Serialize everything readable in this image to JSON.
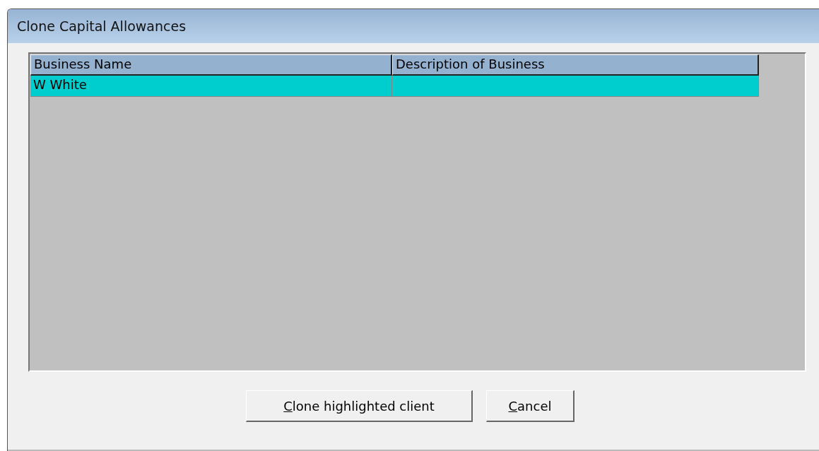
{
  "window": {
    "title": "Clone Capital Allowances"
  },
  "table": {
    "columns": [
      "Business Name",
      "Description of Business"
    ],
    "rows": [
      {
        "cells": [
          "W White",
          ""
        ],
        "selected": true
      }
    ]
  },
  "buttons": [
    "Clone highlighted client",
    "Cancel"
  ]
}
